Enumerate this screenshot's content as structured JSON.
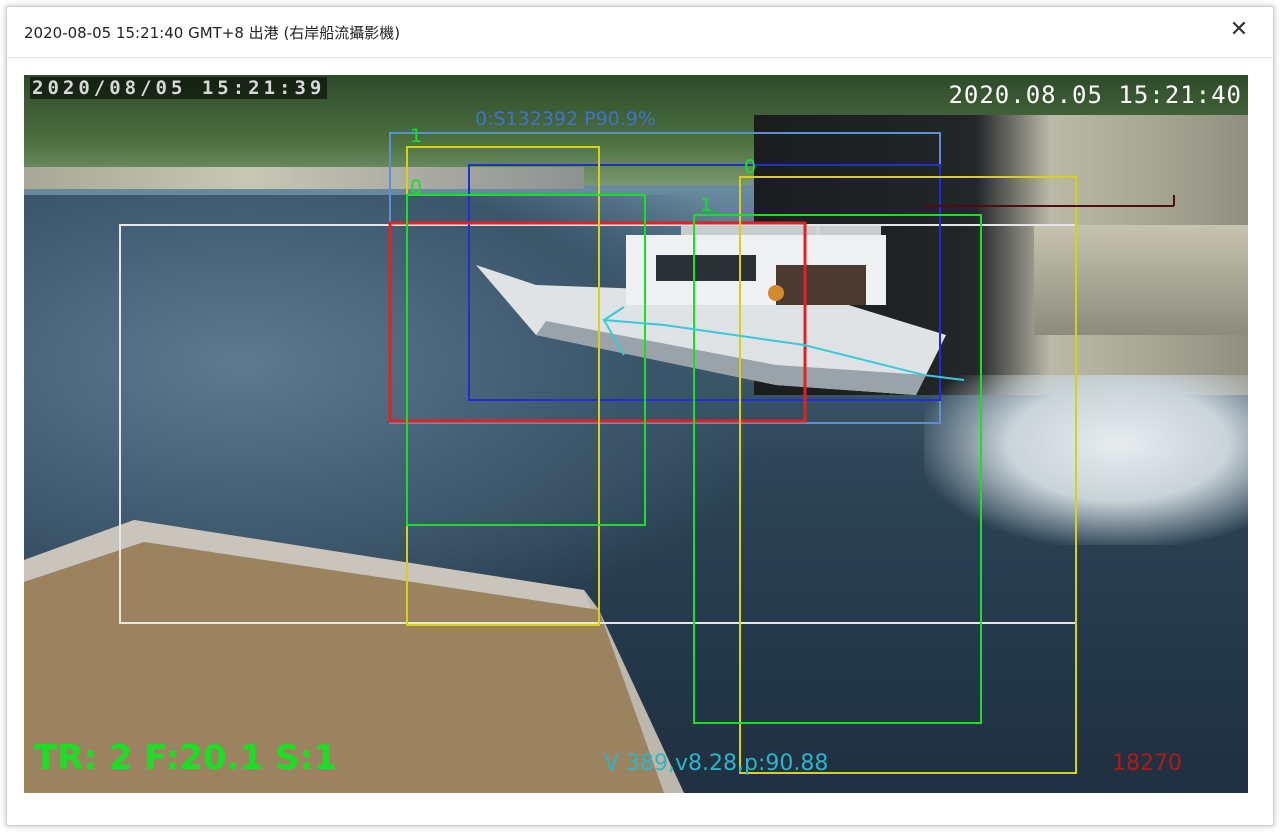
{
  "dialog": {
    "title": "2020-08-05 15:21:40 GMT+8 出港 (右岸船流攝影機)",
    "close_icon": "close-icon",
    "close_glyph": "✕"
  },
  "video": {
    "osd_timestamp_left": "2020/08/05 15:21:39",
    "osd_timestamp_right": "2020.08.05 15:21:40",
    "detection_label": "0:S132392 P90.9%",
    "stats": "TR: 2 F:20.1 S:1",
    "velocity": "V 389,v8.28,p:90.88",
    "frame": "18270",
    "track_labels": [
      "1",
      "0",
      "0",
      "1"
    ],
    "colors": {
      "green": "#19e024",
      "yellow": "#d6d21a",
      "blue": "#1f2fd0",
      "light_blue": "#5b8fd6",
      "cyan": "#39c9d9",
      "red": "#e0231f",
      "white": "#e6e6e6"
    }
  }
}
